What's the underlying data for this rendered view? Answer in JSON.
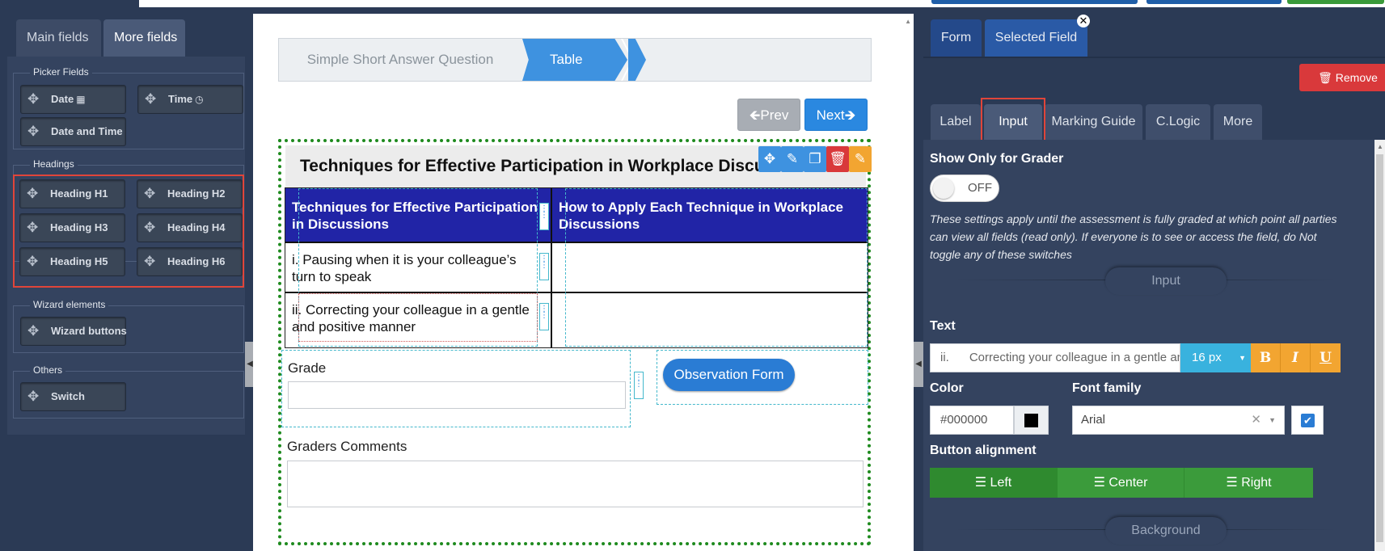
{
  "colors": {
    "panel_bg": "#2b3a55",
    "accent_blue": "#3e92e0",
    "table_header": "#2124a6",
    "remove_red": "#d9393b",
    "format_orange": "#f2a531",
    "align_green": "#3b9b3b",
    "highlight_red": "#e0453a"
  },
  "left_panel": {
    "tabs": [
      {
        "label": "Main fields",
        "active": false
      },
      {
        "label": "More fields",
        "active": true
      }
    ],
    "groups": {
      "picker": {
        "legend": "Picker Fields",
        "items": [
          {
            "label": "Date",
            "icon": "calendar-icon"
          },
          {
            "label": "Time",
            "icon": "clock-icon"
          },
          {
            "label": "Date and Time"
          }
        ]
      },
      "headings": {
        "legend": "Headings",
        "items": [
          {
            "label": "Heading H1"
          },
          {
            "label": "Heading H2"
          },
          {
            "label": "Heading H3"
          },
          {
            "label": "Heading H4"
          },
          {
            "label": "Heading H5"
          },
          {
            "label": "Heading H6"
          }
        ]
      },
      "wizard": {
        "legend": "Wizard elements",
        "items": [
          {
            "label": "Wizard buttons"
          }
        ]
      },
      "others": {
        "legend": "Others",
        "items": [
          {
            "label": "Switch"
          }
        ]
      }
    }
  },
  "form": {
    "wizard_steps": [
      {
        "label": "Simple Short Answer Question",
        "active": false
      },
      {
        "label": "Table",
        "active": true
      }
    ],
    "prev_label": "Prev",
    "next_label": "Next",
    "table_title": "Techniques for Effective Participation in Workplace Discussions",
    "table": {
      "headers": [
        "Techniques for Effective Participation in Discussions",
        "How to Apply Each Technique in Workplace Discussions"
      ],
      "rows": [
        [
          "i. Pausing when it is your colleague’s turn to speak",
          ""
        ],
        [
          "ii. Correcting your colleague in a gentle and positive manner",
          ""
        ]
      ]
    },
    "grade_label": "Grade",
    "grade_value": "",
    "observation_button": "Observation Form",
    "graders_comments_label": "Graders Comments",
    "graders_comments_value": ""
  },
  "right_panel": {
    "tabs": [
      {
        "label": "Form",
        "active": false
      },
      {
        "label": "Selected Field",
        "active": true
      }
    ],
    "remove_label": "Remove",
    "subtabs": [
      {
        "label": "Label",
        "active": false
      },
      {
        "label": "Input",
        "active": true
      },
      {
        "label": "Marking Guide",
        "active": false
      },
      {
        "label": "C.Logic",
        "active": false
      },
      {
        "label": "More",
        "active": false
      }
    ],
    "show_only_grader_label": "Show Only for Grader",
    "toggle_state": "OFF",
    "note": "These settings apply until the assessment is fully graded at which point all parties can view all fields (read only). If everyone is to see or access the field, do Not toggle any of these switches",
    "input_divider": "Input",
    "text_label": "Text",
    "text_value": "ii.      Correcting your colleague in a gentle and positive manner",
    "font_size": "16 px",
    "bold_label": "B",
    "italic_label": "I",
    "underline_label": "U",
    "color_label": "Color",
    "color_value": "#000000",
    "font_family_label": "Font family",
    "font_family_value": "Arial",
    "font_checkbox_checked": true,
    "button_alignment_label": "Button alignment",
    "alignments": [
      {
        "label": "Left",
        "active": true
      },
      {
        "label": "Center",
        "active": false
      },
      {
        "label": "Right",
        "active": false
      }
    ],
    "background_divider": "Background"
  }
}
